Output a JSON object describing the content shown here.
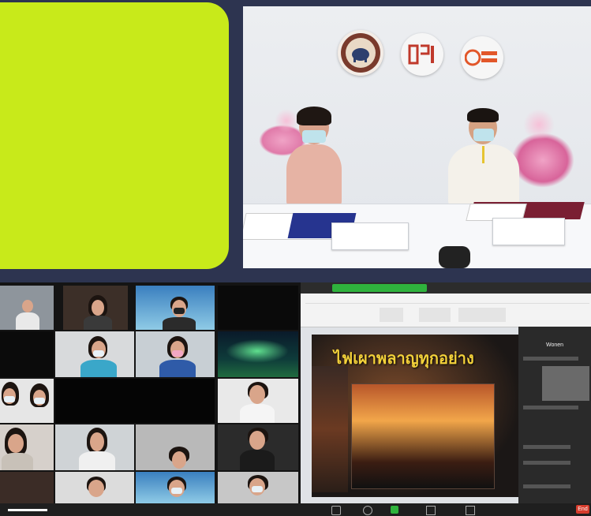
{
  "colors": {
    "background": "#2d3450",
    "lime_panel": "#c8ea1a",
    "zoom_bg": "#111111",
    "slide_title": "#f3d13a",
    "end_button": "#d63b2b"
  },
  "logos": [
    "elephant-seal-logo",
    "dri-logo",
    "sci-park-logo"
  ],
  "zoom": {
    "share_banner": "",
    "slide_title": "ไฟเผาพลาญทุกอย่าง",
    "sidebar_title": "Wonen",
    "end_label": "End"
  }
}
